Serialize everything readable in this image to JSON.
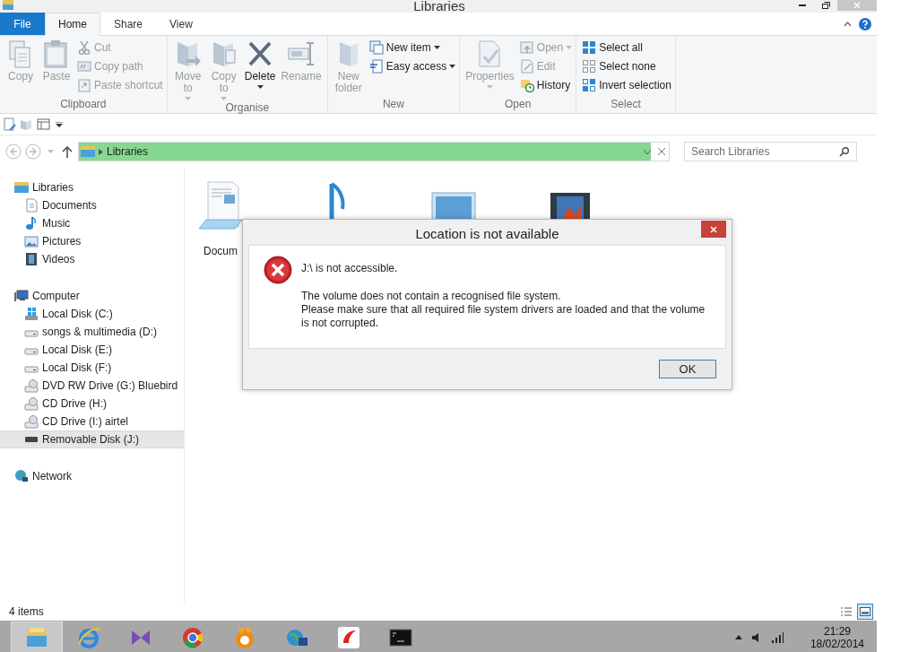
{
  "window": {
    "title": "Libraries"
  },
  "ribbon": {
    "tabs": [
      {
        "label": "File",
        "kind": "file",
        "selected": false
      },
      {
        "label": "Home",
        "kind": "tab",
        "selected": true
      },
      {
        "label": "Share",
        "kind": "tab",
        "selected": false
      },
      {
        "label": "View",
        "kind": "tab",
        "selected": false
      }
    ],
    "groups": [
      {
        "label": "Clipboard",
        "large": [
          {
            "label": "Copy",
            "disabled": true,
            "dropdown": false
          },
          {
            "label": "Paste",
            "disabled": true,
            "dropdown": false
          }
        ],
        "small": [
          {
            "label": "Cut",
            "disabled": true,
            "dropdown": false
          },
          {
            "label": "Copy path",
            "disabled": true,
            "dropdown": false
          },
          {
            "label": "Paste shortcut",
            "disabled": true,
            "dropdown": false
          }
        ]
      },
      {
        "label": "Organise",
        "large": [
          {
            "label": "Move to",
            "disabled": true,
            "dropdown": true
          },
          {
            "label": "Copy to",
            "disabled": true,
            "dropdown": true
          },
          {
            "label": "Delete",
            "disabled": false,
            "dropdown": true
          },
          {
            "label": "Rename",
            "disabled": true,
            "dropdown": false
          }
        ]
      },
      {
        "label": "New",
        "large": [
          {
            "label": "New folder",
            "disabled": true,
            "dropdown": false
          }
        ],
        "small": [
          {
            "label": "New item",
            "disabled": false,
            "dropdown": true
          },
          {
            "label": "Easy access",
            "disabled": false,
            "dropdown": true
          }
        ]
      },
      {
        "label": "Open",
        "large": [
          {
            "label": "Properties",
            "disabled": true,
            "dropdown": true
          }
        ],
        "small": [
          {
            "label": "Open",
            "disabled": true,
            "dropdown": true
          },
          {
            "label": "Edit",
            "disabled": true,
            "dropdown": false
          },
          {
            "label": "History",
            "disabled": false,
            "dropdown": false
          }
        ]
      },
      {
        "label": "Select",
        "small": [
          {
            "label": "Select all",
            "disabled": false,
            "dropdown": false
          },
          {
            "label": "Select none",
            "disabled": false,
            "dropdown": false
          },
          {
            "label": "Invert selection",
            "disabled": false,
            "dropdown": false
          }
        ]
      }
    ]
  },
  "address_bar": {
    "path": "Libraries",
    "level": 0.97
  },
  "search": {
    "placeholder": "Search Libraries"
  },
  "navigation": [
    {
      "label": "Libraries",
      "kind": "library",
      "selected": false,
      "children": [
        {
          "label": "Documents",
          "kind": "documents",
          "selected": false
        },
        {
          "label": "Music",
          "kind": "music",
          "selected": false
        },
        {
          "label": "Pictures",
          "kind": "pictures",
          "selected": false
        },
        {
          "label": "Videos",
          "kind": "videos",
          "selected": false
        }
      ]
    },
    {
      "label": "Computer",
      "kind": "computer",
      "selected": false,
      "children": [
        {
          "label": "Local Disk (C:)",
          "kind": "system",
          "selected": false
        },
        {
          "label": "songs & multimedia (D:)",
          "kind": "drive",
          "selected": false
        },
        {
          "label": "Local Disk (E:)",
          "kind": "drive",
          "selected": false
        },
        {
          "label": "Local Disk (F:)",
          "kind": "drive",
          "selected": false
        },
        {
          "label": "DVD RW Drive (G:) Bluebird",
          "kind": "optical",
          "selected": false
        },
        {
          "label": "CD Drive (H:)",
          "kind": "optical",
          "selected": false
        },
        {
          "label": "CD Drive (I:) airtel",
          "kind": "optical",
          "selected": false
        },
        {
          "label": "Removable Disk (J:)",
          "kind": "removable",
          "selected": true
        }
      ]
    },
    {
      "label": "Network",
      "kind": "network",
      "selected": false
    }
  ],
  "content": {
    "items": [
      {
        "kind": "documents",
        "label": "Docum"
      },
      {
        "kind": "music"
      },
      {
        "kind": "pictures"
      },
      {
        "kind": "videos"
      }
    ]
  },
  "dialog": {
    "title": "Location is not available",
    "heading": "J:\\ is not accessible.",
    "message": [
      "The volume does not contain a recognised file system.",
      "Please make sure that all required file system drivers are loaded and that the volume is not corrupted."
    ],
    "button": "OK"
  },
  "status_bar": {
    "count": "4 items",
    "views": [
      {
        "kind": "details",
        "selected": false
      },
      {
        "kind": "large",
        "selected": true
      }
    ]
  },
  "taskbar": {
    "apps": [
      {
        "kind": "explorer",
        "selected": true
      },
      {
        "kind": "ie",
        "selected": false
      },
      {
        "kind": "vs",
        "selected": false
      },
      {
        "kind": "chrome",
        "selected": false
      },
      {
        "kind": "orb",
        "selected": false
      },
      {
        "kind": "globe",
        "selected": false
      },
      {
        "kind": "swoosh",
        "selected": false
      },
      {
        "kind": "cmd",
        "selected": false
      }
    ],
    "time": "21:29",
    "date": "18/02/2014"
  }
}
